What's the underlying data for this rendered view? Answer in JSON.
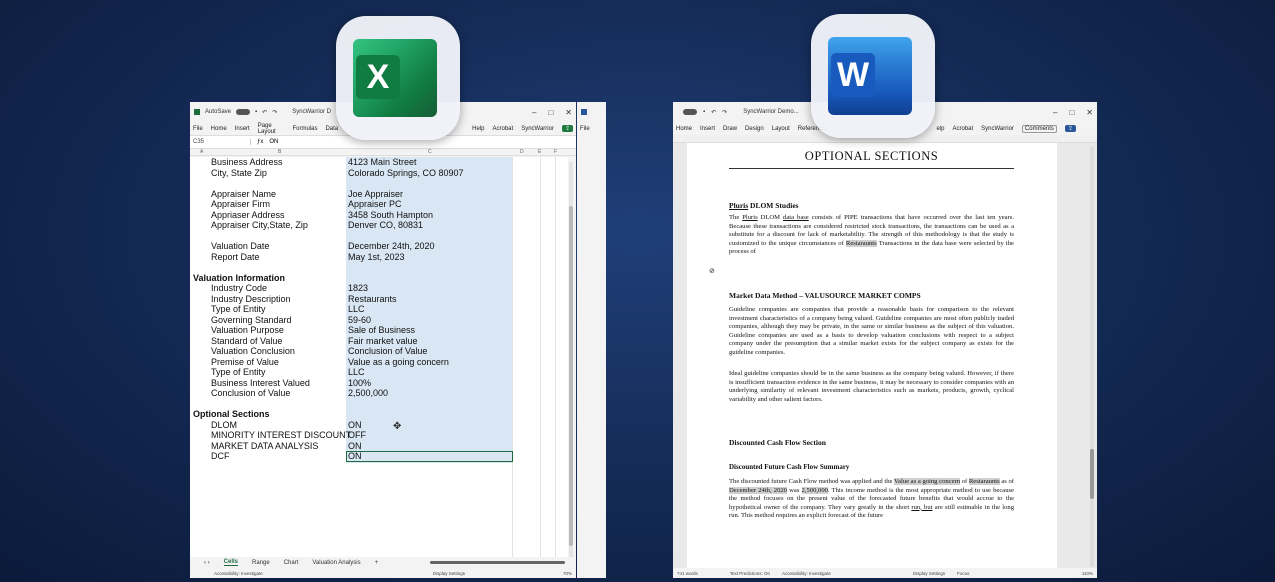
{
  "excel": {
    "title": "SyncWarrior D",
    "autosave_label": "AutoSave",
    "menu": [
      "File",
      "Home",
      "Insert",
      "Page Layout",
      "Formulas",
      "Data",
      "Help",
      "Acrobat",
      "SyncWarrior"
    ],
    "name_box": "C35",
    "formula_value": "ON",
    "col_headers": [
      "A",
      "B",
      "C",
      "D",
      "E",
      "F"
    ],
    "rows": [
      {
        "label": "Business Address",
        "value": "4123 Main Street"
      },
      {
        "label": "City, State Zip",
        "value": "Colorado Springs, CO 80907"
      },
      {
        "label": "",
        "value": ""
      },
      {
        "label": "Appraiser Name",
        "value": "Joe Appraiser"
      },
      {
        "label": "Appraiser Firm",
        "value": "Appraiser PC"
      },
      {
        "label": "Appriaser Address",
        "value": "3458 South Hampton"
      },
      {
        "label": "Appraiser City,State, Zip",
        "value": "Denver CO, 80831"
      },
      {
        "label": "",
        "value": ""
      },
      {
        "label": "Valuation Date",
        "value": "December 24th, 2020"
      },
      {
        "label": "Report Date",
        "value": "May 1st, 2023"
      },
      {
        "label": "",
        "value": ""
      },
      {
        "header": "Valuation Information"
      },
      {
        "label": "Industry Code",
        "value": "1823"
      },
      {
        "label": "Industry Description",
        "value": "Restaurants"
      },
      {
        "label": "Type of Entity",
        "value": "LLC"
      },
      {
        "label": "Governing Standard",
        "value": "59-60"
      },
      {
        "label": "Valuation Purpose",
        "value": "Sale of Business"
      },
      {
        "label": "Standard of Value",
        "value": "Fair market value"
      },
      {
        "label": "Valuation Conclusion",
        "value": "Conclusion of Value"
      },
      {
        "label": "Premise of Value",
        "value": "Value as a going concern"
      },
      {
        "label": "Type of Entity",
        "value": "LLC"
      },
      {
        "label": "Business Interest Valued",
        "value": "100%"
      },
      {
        "label": "Conclusion of Value",
        "value": "2,500,000"
      },
      {
        "label": "",
        "value": ""
      },
      {
        "header": "Optional Sections"
      },
      {
        "label": "DLOM",
        "value": "ON"
      },
      {
        "label": "MINORITY INTEREST DISCOUNT",
        "value": "OFF"
      },
      {
        "label": "MARKET DATA ANALYSIS",
        "value": "ON"
      },
      {
        "label": "DCF",
        "value": "ON"
      }
    ],
    "sheet_tabs": [
      "Cells",
      "Range",
      "Chart",
      "Valuation Analysis"
    ],
    "add_sheet": "+",
    "status": {
      "accessibility": "Accessibility: Investigate",
      "display": "Display Settings",
      "zoom": "70%"
    }
  },
  "word": {
    "title": "SyncWarrior Demo...",
    "menu": [
      "Home",
      "Insert",
      "Draw",
      "Design",
      "Layout",
      "References",
      "elp",
      "Acrobat",
      "SyncWarrior"
    ],
    "comments_label": "Comments",
    "heading": "OPTIONAL SECTIONS",
    "s1_title_a": "Pluris",
    "s1_title_b": " DLOM Studies",
    "s1_p1": "The ",
    "s1_p1_u1": "Pluris",
    "s1_p1_b": " DLOM ",
    "s1_p1_u2": "data base",
    "s1_p1_c": " consists of PIPE transactions that have occurred over the last ten years. Because these transactions are considered restricted stock transactions, the transactions can be used as a substitute for a discount for lack of marketability. The strength of this methodology is that the study is customized to the unique circumstances of ",
    "s1_p1_hl": "Restaraunts",
    "s1_p1_d": " Transactions in the data base were selected by the process of",
    "s2_title": "Market Data Method – VALUSOURCE MARKET COMPS",
    "s2_p1": "Guideline companies are companies that provide a reasonable basis for comparison to the relevant investment characteristics of a company being valued. Guideline companies are most often publicly traded companies, although they may be private, in the same or similar business as the subject of this valuation. Guideline companies are used as a basis to develop valuation conclusions with respect to a subject company under the presumption that a similar market exists for the subject company as exists for the guideline companies.",
    "s2_p2": "Ideal guideline companies should be in the same business as the company being valued. However, if there is insufficient transaction evidence in the same business, it may be necessary to consider companies with an underlying similarity of relevant investment characteristics such as markets, products, growth, cyclical variability and other salient factors.",
    "s3_title": "Discounted Cash Flow Section",
    "s4_title": "Discounted Future Cash Flow Summary",
    "s4_a": "The discounted future Cash Flow method was applied and the ",
    "s4_hl1": "Value as a going concern",
    "s4_b": " of ",
    "s4_hl2": "Restaraunts",
    "s4_c": " as of ",
    "s4_hl3": "December 24th, 2020",
    "s4_d": " was ",
    "s4_hl4": "2,500,000",
    "s4_e": ". This income method is the most appropriate method to use because the method focuses on the present value of the forecasted future benefits that would accrue to the hypothetical owner of the company. They vary greatly in the short ",
    "s4_u": "run, but",
    "s4_f": " are still estimable in the long run. This method requires an explicit forecast of the future",
    "status": {
      "words": "741 words",
      "predictions": "Text Predictions: On",
      "accessibility": "Accessibility: Investigate",
      "display": "Display Settings",
      "focus": "Focus",
      "zoom": "110%"
    }
  },
  "colors": {
    "excel_green": "#1e6b3d",
    "word_blue": "#2b579a",
    "selection_band": "#d9e6f3"
  }
}
